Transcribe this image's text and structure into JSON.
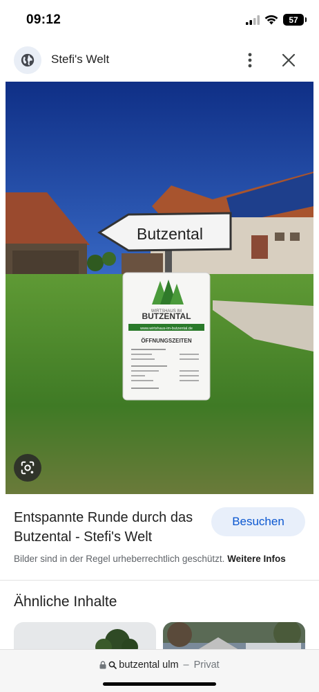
{
  "status_bar": {
    "time": "09:12",
    "battery": "57"
  },
  "header": {
    "site_name": "Stefi's Welt",
    "site_icon": "globe-icon",
    "more_icon": "more-vert-icon",
    "close_icon": "close-icon"
  },
  "image": {
    "sign_arrow_text": "Butzental",
    "board": {
      "small_top": "WIRTSHAUS IM",
      "brand": "BUTZENTAL",
      "url": "www.wirtshaus-im-butzental.de",
      "heading": "ÖFFNUNGSZEITEN"
    },
    "lens_icon": "google-lens-icon"
  },
  "result": {
    "title": "Entspannte Runde durch das Butzental - Stefi's Welt",
    "visit_label": "Besuchen",
    "copyright_text": "Bilder sind in der Regel urheberrechtlich geschützt.",
    "more_info_label": "Weitere Infos"
  },
  "similar": {
    "heading": "Ähnliche Inhalte"
  },
  "url_bar": {
    "query": "butzental ulm",
    "separator": "–",
    "mode": "Privat",
    "lock_icon": "lock-icon",
    "search_icon": "search-icon"
  },
  "colors": {
    "accent": "#0b57d0",
    "visit_bg": "#e8effa",
    "sky": "#1a3f9a",
    "grass": "#4e8a2c"
  }
}
